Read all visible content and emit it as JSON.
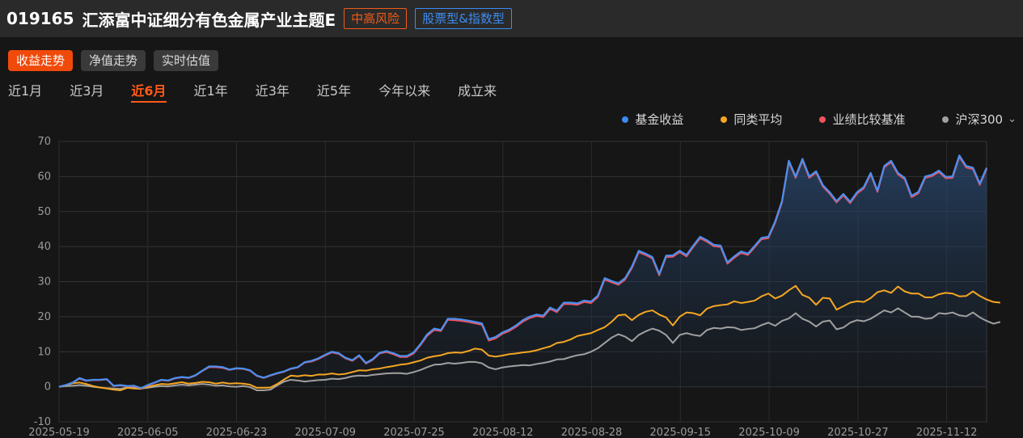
{
  "header": {
    "code": "019165",
    "name": "汇添富中证细分有色金属产业主题E",
    "risk_tag": "中高风险",
    "type_tag": "股票型&指数型"
  },
  "tabs": [
    {
      "label": "收益走势",
      "active": true
    },
    {
      "label": "净值走势",
      "active": false
    },
    {
      "label": "实时估值",
      "active": false
    }
  ],
  "periods": [
    {
      "label": "近1月",
      "active": false
    },
    {
      "label": "近3月",
      "active": false
    },
    {
      "label": "近6月",
      "active": true
    },
    {
      "label": "近1年",
      "active": false
    },
    {
      "label": "近3年",
      "active": false
    },
    {
      "label": "近5年",
      "active": false
    },
    {
      "label": "今年以来",
      "active": false
    },
    {
      "label": "成立来",
      "active": false
    }
  ],
  "legend": [
    {
      "label": "基金收益",
      "color": "#3d8bf2"
    },
    {
      "label": "同类平均",
      "color": "#f5a623"
    },
    {
      "label": "业绩比较基准",
      "color": "#f0535c"
    },
    {
      "label": "沪深300",
      "color": "#a0a0a0"
    }
  ],
  "chart_data": {
    "type": "line",
    "ylim": [
      -10,
      70
    ],
    "yticks": [
      -10,
      0,
      10,
      20,
      30,
      40,
      50,
      60,
      70
    ],
    "xtick_labels": [
      "2025-05-19",
      "2025-06-05",
      "2025-06-23",
      "2025-07-09",
      "2025-07-25",
      "2025-08-12",
      "2025-08-28",
      "2025-09-15",
      "2025-10-09",
      "2025-10-27",
      "2025-11-12"
    ],
    "grid": true,
    "series": [
      {
        "name": "基金收益",
        "color": "#4a8ff0",
        "fill": true,
        "values": [
          0,
          0.5,
          1.2,
          2.5,
          1.8,
          2,
          2,
          2.2,
          0.3,
          0.5,
          0.2,
          0.3,
          -0.4,
          0.5,
          1.2,
          2,
          1.8,
          2.5,
          2.8,
          2.6,
          3.3,
          4.6,
          5.8,
          5.8,
          5.6,
          4.9,
          5.3,
          5.2,
          4.7,
          3.2,
          2.6,
          3.3,
          3.9,
          4.4,
          5.2,
          5.6,
          7,
          7.4,
          8.1,
          9.1,
          10,
          9.6,
          8.3,
          7.6,
          9,
          6.8,
          7.9,
          9.7,
          10.2,
          9.6,
          8.8,
          8.8,
          9.8,
          12.2,
          15,
          16.6,
          16.2,
          19.4,
          19.4,
          19.2,
          18.9,
          18.5,
          18.1,
          13.6,
          14.2,
          15.5,
          16.3,
          17.5,
          19,
          20,
          20.6,
          20.3,
          22.6,
          21.7,
          24,
          24,
          23.8,
          24.6,
          24.3,
          26,
          31,
          30.2,
          29.5,
          31,
          34.3,
          38.8,
          38,
          37,
          32.2,
          37.4,
          37.5,
          38.8,
          37.6,
          40.3,
          42.8,
          41.8,
          40.5,
          40.3,
          35.5,
          37.2,
          38.6,
          38,
          40.2,
          42.5,
          42.8,
          47.2,
          53,
          64.5,
          60,
          65,
          60,
          61.5,
          57.5,
          55.5,
          53,
          55,
          52.8,
          55.5,
          57,
          61,
          56,
          63,
          64.5,
          61,
          59.6,
          54.5,
          55.6,
          60,
          60.5,
          61.7,
          59.9,
          60,
          66,
          63,
          62.5,
          58,
          62.5
        ]
      },
      {
        "name": "业绩比较基准",
        "color": "#f0535c",
        "fill": false,
        "values": [
          0,
          0.5,
          1.2,
          2.3,
          1.7,
          1.9,
          1.9,
          2.1,
          0.2,
          0.4,
          0.1,
          0.2,
          -0.5,
          0.4,
          1.1,
          1.9,
          1.7,
          2.4,
          2.7,
          2.5,
          3.2,
          4.5,
          5.6,
          5.6,
          5.4,
          4.8,
          5.2,
          5.1,
          4.6,
          3.1,
          2.5,
          3.2,
          3.8,
          4.3,
          5.1,
          5.5,
          6.9,
          7.2,
          7.9,
          8.9,
          9.8,
          9.4,
          8.1,
          7.4,
          8.8,
          6.6,
          7.7,
          9.5,
          9.9,
          9.3,
          8.5,
          8.5,
          9.5,
          11.9,
          14.6,
          16.2,
          15.9,
          19.1,
          19,
          18.8,
          18.5,
          18.1,
          17.7,
          13.2,
          13.8,
          15.1,
          15.9,
          17.1,
          18.6,
          19.6,
          20.2,
          19.9,
          22.2,
          21.3,
          23.6,
          23.6,
          23.4,
          24.2,
          23.9,
          25.6,
          30.6,
          29.8,
          29.1,
          30.6,
          33.9,
          38.4,
          37.6,
          36.6,
          31.8,
          37,
          37.1,
          38.4,
          37.2,
          39.9,
          42.4,
          41.4,
          40.1,
          39.9,
          35.1,
          36.8,
          38.2,
          37.6,
          39.8,
          42.1,
          42.4,
          46.8,
          52.6,
          64.1,
          59.6,
          64.6,
          59.6,
          61.1,
          57.1,
          55.1,
          52.6,
          54.6,
          52.4,
          55.1,
          56.6,
          60.6,
          55.6,
          62.6,
          64.1,
          60.6,
          59.2,
          54.1,
          55.2,
          59.6,
          60.1,
          61.3,
          59.5,
          59.6,
          65.6,
          62.6,
          62.1,
          57.6,
          62.1
        ]
      },
      {
        "name": "同类平均",
        "color": "#f5a623",
        "fill": false,
        "values": [
          0,
          0.4,
          1,
          1.2,
          0.8,
          0.2,
          -0.2,
          -0.5,
          -0.8,
          -1,
          -0.3,
          -0.5,
          -0.6,
          0,
          0.4,
          0.8,
          0.7,
          1,
          1.3,
          0.9,
          1.1,
          1.4,
          1.3,
          0.9,
          1.2,
          0.9,
          1,
          0.9,
          0.6,
          -0.3,
          -0.3,
          -0.2,
          0.8,
          2.1,
          3.2,
          3,
          3.3,
          3.1,
          3.5,
          3.5,
          3.8,
          3.5,
          3.7,
          4.2,
          4.7,
          4.6,
          5,
          5.2,
          5.6,
          5.9,
          6.3,
          6.5,
          7,
          7.5,
          8.3,
          8.7,
          9,
          9.6,
          9.8,
          9.7,
          10.2,
          10.9,
          10.6,
          8.9,
          8.6,
          8.9,
          9.3,
          9.5,
          9.8,
          10,
          10.4,
          11,
          11.5,
          12.5,
          12.8,
          13.5,
          14.5,
          14.9,
          15.3,
          16.2,
          17,
          18.5,
          20.4,
          20.6,
          19,
          20.5,
          21.4,
          21.8,
          20.6,
          19.8,
          17.5,
          20,
          21.2,
          21,
          20.4,
          22.3,
          23,
          23.3,
          23.5,
          24.4,
          23.9,
          24.2,
          24.6,
          25.8,
          26.6,
          25.2,
          26,
          27.5,
          28.8,
          26.2,
          25.4,
          23.4,
          25.4,
          25.2,
          22,
          23,
          24,
          24.4,
          24.2,
          25.3,
          27,
          27.5,
          26.8,
          28.6,
          27.2,
          26.6,
          26.6,
          25.5,
          25.5,
          26.4,
          26.8,
          26.6,
          25.8,
          25.9,
          27.2,
          25.9,
          24.9,
          24.2,
          24
        ]
      },
      {
        "name": "沪深300",
        "color": "#a0a0a0",
        "fill": false,
        "values": [
          0,
          0.2,
          0.3,
          0.5,
          0.3,
          0,
          -0.2,
          -0.4,
          -0.5,
          -0.6,
          -0.2,
          -0.3,
          -0.5,
          -0.3,
          0,
          0.2,
          0.1,
          0.4,
          0.6,
          0.4,
          0.6,
          0.8,
          0.6,
          0.3,
          0.4,
          0.1,
          0,
          0.2,
          -0.1,
          -1,
          -1,
          -0.8,
          0.4,
          1.5,
          2,
          1.8,
          1.5,
          1.7,
          1.9,
          2,
          2.3,
          2.2,
          2.5,
          3,
          3.2,
          3.1,
          3.4,
          3.6,
          3.8,
          3.9,
          3.9,
          3.7,
          4.2,
          4.8,
          5.6,
          6.3,
          6.4,
          6.8,
          6.6,
          6.8,
          7.1,
          7.1,
          6.7,
          5.5,
          5,
          5.5,
          5.8,
          6,
          6.2,
          6.1,
          6.5,
          6.8,
          7.2,
          7.8,
          7.9,
          8.5,
          9,
          9.3,
          10,
          11,
          12.5,
          14,
          15,
          14.3,
          13,
          14.8,
          15.8,
          16.6,
          16,
          14.8,
          12.5,
          14.8,
          15.3,
          14.8,
          14.5,
          16.2,
          16.8,
          16.6,
          17,
          16.9,
          16.2,
          16.5,
          16.7,
          17.6,
          18.3,
          17.4,
          18.8,
          19.5,
          21,
          19.4,
          18.6,
          17.2,
          18.6,
          18.9,
          16.4,
          16.9,
          18.3,
          19,
          18.7,
          19.4,
          20.6,
          21.8,
          21.2,
          22.4,
          21.2,
          20,
          20,
          19.4,
          19.6,
          21,
          20.8,
          21.2,
          20.4,
          20.1,
          21.2,
          19.8,
          18.8,
          18,
          18.5
        ]
      }
    ]
  }
}
